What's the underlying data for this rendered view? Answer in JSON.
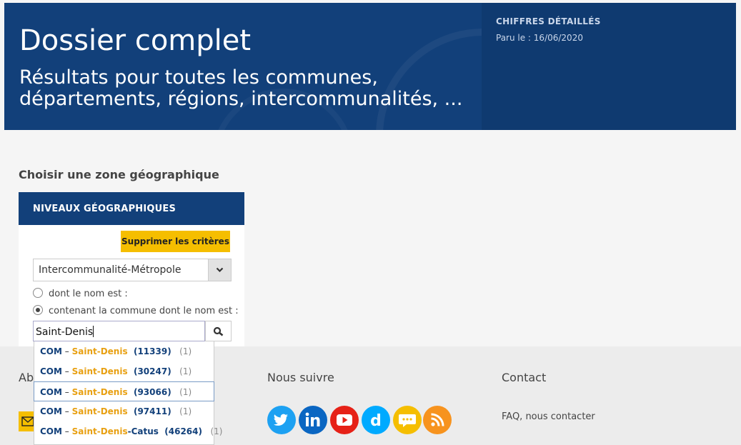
{
  "banner": {
    "title": "Dossier complet",
    "subtitle": "Résultats pour toutes les communes, départements, régions, intercommunalités, ...",
    "kicker": "CHIFFRES DÉTAILLÉS",
    "published": "Paru le : 16/06/2020"
  },
  "zone": {
    "heading": "Choisir une zone géographique",
    "panel_title": "NIVEAUX GÉOGRAPHIQUES",
    "clear_label": "Supprimer les critères",
    "select_value": "Intercommunalité-Métropole",
    "radio_name": "dont le nom est :",
    "radio_contains": "contenant la commune dont le nom est :",
    "radio_selected": "contains",
    "search_value": "Saint-Denis"
  },
  "dropdown": {
    "items": [
      {
        "prefix": "COM",
        "sep": " – ",
        "name": "Saint-Denis",
        "suffix": "",
        "code": "(11339)",
        "count": "(1)"
      },
      {
        "prefix": "COM",
        "sep": " – ",
        "name": "Saint-Denis",
        "suffix": "",
        "code": "(30247)",
        "count": "(1)"
      },
      {
        "prefix": "COM",
        "sep": " – ",
        "name": "Saint-Denis",
        "suffix": "",
        "code": "(93066)",
        "count": "(1)"
      },
      {
        "prefix": "COM",
        "sep": " – ",
        "name": "Saint-Denis",
        "suffix": "",
        "code": "(97411)",
        "count": "(1)"
      },
      {
        "prefix": "COM",
        "sep": " – ",
        "name": "Saint-Denis",
        "suffix": "-Catus",
        "code": "(46264)",
        "count": "(1)"
      }
    ],
    "active_index": 2
  },
  "footer": {
    "about_heading": "Ab",
    "follow_heading": "Nous suivre",
    "contact_heading": "Contact",
    "faq_link": "FAQ, nous contacter",
    "social": [
      {
        "icon": "twitter-icon",
        "color": "#1da1f2"
      },
      {
        "icon": "linkedin-icon",
        "color": "#0a66c2"
      },
      {
        "icon": "youtube-icon",
        "color": "#e62117"
      },
      {
        "icon": "dailymotion-icon",
        "color": "#00aaff"
      },
      {
        "icon": "blog-icon",
        "color": "#f5be00"
      },
      {
        "icon": "rss-icon",
        "color": "#f7931e"
      }
    ]
  },
  "colors": {
    "brand_blue": "#12407a",
    "accent_yellow": "#f5be00",
    "highlight_orange": "#e8a012"
  }
}
